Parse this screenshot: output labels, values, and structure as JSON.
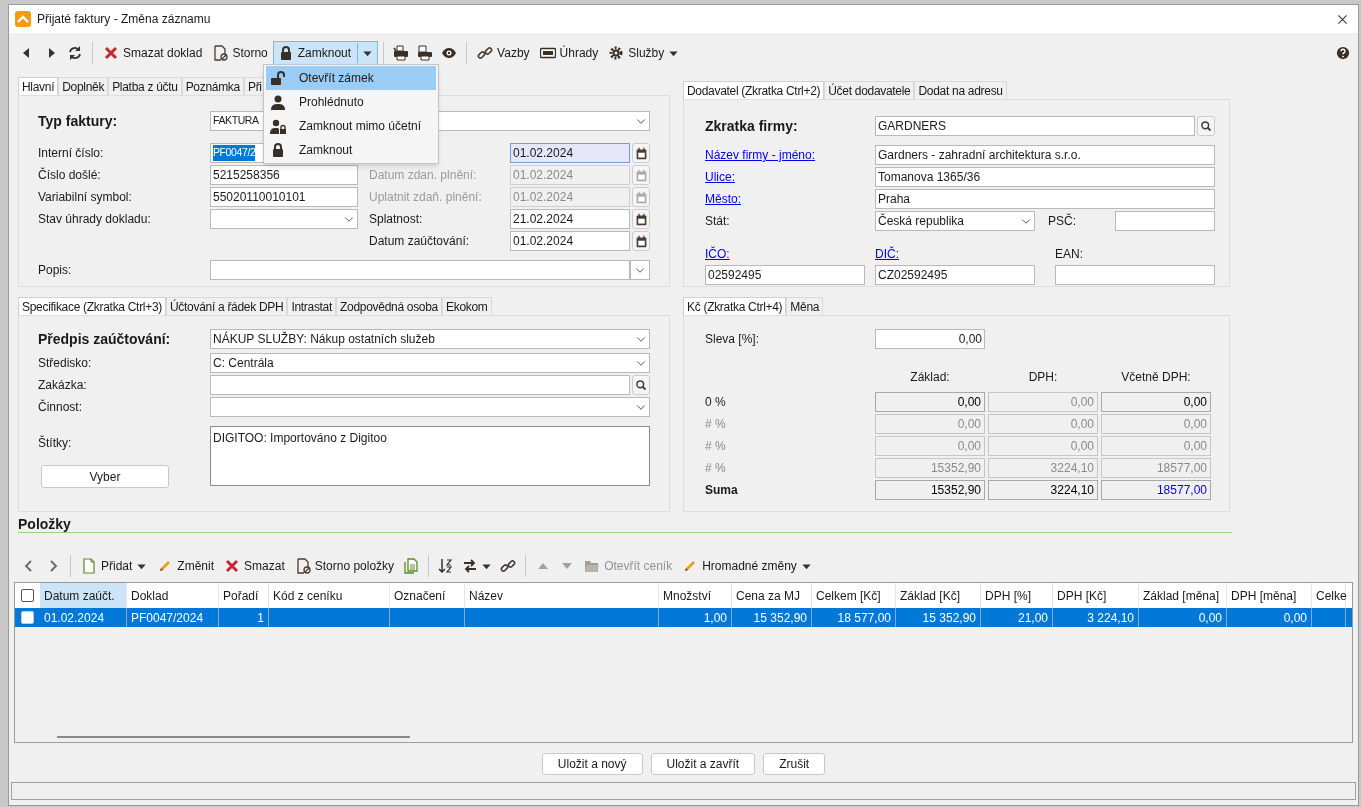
{
  "window": {
    "title": "Přijaté faktury - Změna záznamu"
  },
  "toolbar": {
    "items": [
      {
        "kind": "icon"
      },
      {
        "kind": "icon"
      },
      {
        "kind": "icon"
      },
      {
        "kind": "separator"
      },
      {
        "kind": "button",
        "label": "Smazat doklad"
      },
      {
        "kind": "button",
        "label": "Storno"
      },
      {
        "kind": "split",
        "label": "Zamknout",
        "expanded": true
      },
      {
        "kind": "separator"
      },
      {
        "kind": "icon"
      },
      {
        "kind": "icon"
      },
      {
        "kind": "icon"
      },
      {
        "kind": "separator"
      },
      {
        "kind": "button",
        "label": "Vazby"
      },
      {
        "kind": "button",
        "label": "Úhrady"
      },
      {
        "kind": "menu",
        "label": "Služby"
      }
    ]
  },
  "lock_menu": {
    "items": [
      {
        "label": "Otevřít zámek",
        "selected": true
      },
      {
        "label": "Prohlédnuto",
        "selected": false
      },
      {
        "label": "Zamknout mimo účetní",
        "selected": false
      },
      {
        "label": "Zamknout",
        "selected": false
      }
    ]
  },
  "main_form": {
    "tabs": [
      {
        "label": "Hlavní",
        "selected": true
      },
      {
        "label": "Doplněk",
        "selected": false
      },
      {
        "label": "Platba z účtu",
        "selected": false
      },
      {
        "label": "Poznámka",
        "selected": false
      },
      {
        "label": "Při",
        "selected": false
      }
    ],
    "invoice_type": {
      "label": "Typ faktury:",
      "value": "FAKTURA"
    },
    "fields": [
      {
        "label": "Interní číslo:",
        "value": "PF0047/2",
        "text_selected": true
      },
      {
        "label": "Číslo došlé:",
        "value": "5215258356",
        "text_selected": false
      },
      {
        "label": "Variabilní symbol:",
        "value": "55020110010101",
        "text_selected": false
      },
      {
        "label": "Stav úhrady dokladu:",
        "kind": "select"
      }
    ],
    "dates": [
      {
        "value": "01.02.2024",
        "focused": true,
        "disabled": false
      },
      {
        "label": "Datum zdan. plnění:",
        "value": "01.02.2024",
        "focused": false,
        "disabled": true
      },
      {
        "label": "Uplatnit zdaň. plnění:",
        "value": "01.02.2024",
        "focused": false,
        "disabled": true
      },
      {
        "label": "Splatnost:",
        "value": "21.02.2024",
        "focused": false,
        "disabled": false
      },
      {
        "label": "Datum zaúčtování:",
        "value": "01.02.2024",
        "focused": false,
        "disabled": false
      }
    ],
    "description": {
      "label": "Popis:"
    }
  },
  "supplier": {
    "tabs": [
      {
        "label": "Dodavatel (Zkratka Ctrl+2)",
        "selected": true
      },
      {
        "label": "Účet dodavatele",
        "selected": false
      },
      {
        "label": "Dodat na adresu",
        "selected": false
      }
    ],
    "short_name": {
      "label": "Zkratka firmy:",
      "value": "GARDNERS"
    },
    "fields": [
      {
        "label": "Název firmy - jméno:",
        "value": "Gardners - zahradní architektura s.r.o.",
        "link": true
      },
      {
        "label": "Ulice:",
        "value": "Tomanova 1365/36",
        "link": true
      },
      {
        "label": "Město:",
        "value": "Praha",
        "link": true
      }
    ],
    "country": {
      "label": "Stát:",
      "value": "Česká republika"
    },
    "postal_code": {
      "label": "PSČ:"
    },
    "ids": [
      {
        "label": "IČO:",
        "value": "02592495",
        "link": true
      },
      {
        "label": "DIČ:",
        "value": "CZ02592495",
        "link": true
      },
      {
        "label": "EAN:",
        "link": false
      }
    ]
  },
  "specification": {
    "tabs": [
      {
        "label": "Specifikace (Zkratka Ctrl+3)",
        "selected": true
      },
      {
        "label": "Účtování a řádek DPH",
        "selected": false
      },
      {
        "label": "Intrastat",
        "selected": false
      },
      {
        "label": "Zodpovědná osoba",
        "selected": false
      },
      {
        "label": "Ekokom",
        "selected": false
      }
    ],
    "posting": {
      "label": "Předpis zaúčtování:",
      "value": "NÁKUP SLUŽBY: Nákup ostatních služeb"
    },
    "fields": [
      {
        "label": "Středisko:",
        "value": "C: Centrála",
        "kind": "select"
      },
      {
        "label": "Zakázka:",
        "kind": "search"
      },
      {
        "label": "Činnost:",
        "kind": "select"
      }
    ],
    "tags": {
      "label": "Štítky:",
      "value": "DIGITOO: Importováno z Digitoo",
      "button": "Vyber"
    }
  },
  "amounts": {
    "tabs": [
      {
        "label": "Kč (Zkratka Ctrl+4)",
        "selected": true
      },
      {
        "label": "Měna",
        "selected": false
      }
    ],
    "discount": {
      "label": "Sleva [%]:",
      "value": "0,00"
    },
    "columns": [
      "Základ:",
      "DPH:",
      "Včetně DPH:"
    ],
    "rows": [
      {
        "label": "0 %",
        "kind": "rate",
        "disabled": false,
        "cells": [
          {
            "value": "0,00",
            "disabled": false,
            "emphasized": false
          },
          {
            "value": "0,00",
            "disabled": true,
            "emphasized": false
          },
          {
            "value": "0,00",
            "disabled": false,
            "emphasized": false
          }
        ]
      },
      {
        "label": "# %",
        "kind": "rate",
        "disabled": true,
        "cells": [
          {
            "value": "0,00",
            "disabled": true,
            "emphasized": false
          },
          {
            "value": "0,00",
            "disabled": true,
            "emphasized": false
          },
          {
            "value": "0,00",
            "disabled": true,
            "emphasized": false
          }
        ]
      },
      {
        "label": "# %",
        "kind": "rate",
        "disabled": true,
        "cells": [
          {
            "value": "0,00",
            "disabled": true,
            "emphasized": false
          },
          {
            "value": "0,00",
            "disabled": true,
            "emphasized": false
          },
          {
            "value": "0,00",
            "disabled": true,
            "emphasized": false
          }
        ]
      },
      {
        "label": "# %",
        "kind": "rate",
        "disabled": true,
        "cells": [
          {
            "value": "15352,90",
            "disabled": true,
            "emphasized": false
          },
          {
            "value": "3224,10",
            "disabled": true,
            "emphasized": false
          },
          {
            "value": "18577,00",
            "disabled": true,
            "emphasized": false
          }
        ]
      },
      {
        "label": "Suma",
        "kind": "total",
        "disabled": false,
        "cells": [
          {
            "value": "15352,90",
            "disabled": false,
            "emphasized": false
          },
          {
            "value": "3224,10",
            "disabled": false,
            "emphasized": false
          },
          {
            "value": "18577,00",
            "disabled": false,
            "emphasized": true
          }
        ]
      }
    ]
  },
  "items": {
    "title": "Položky",
    "toolbar": [
      {
        "kind": "icon",
        "disabled": false
      },
      {
        "kind": "icon",
        "disabled": false
      },
      {
        "kind": "separator"
      },
      {
        "kind": "menu",
        "label": "Přidat",
        "disabled": false
      },
      {
        "kind": "button",
        "label": "Změnit",
        "disabled": false
      },
      {
        "kind": "button",
        "label": "Smazat",
        "disabled": false
      },
      {
        "kind": "button",
        "label": "Storno položky",
        "disabled": false
      },
      {
        "kind": "icon",
        "disabled": false
      },
      {
        "kind": "separator"
      },
      {
        "kind": "icon",
        "disabled": false
      },
      {
        "kind": "icon-menu",
        "disabled": false
      },
      {
        "kind": "icon",
        "disabled": false
      },
      {
        "kind": "separator"
      },
      {
        "kind": "icon",
        "disabled": true
      },
      {
        "kind": "icon",
        "disabled": true
      },
      {
        "kind": "button",
        "label": "Otevřít ceník",
        "disabled": true
      },
      {
        "kind": "menu",
        "label": "Hromadné změny",
        "disabled": false
      }
    ],
    "header_checked": false,
    "columns": [
      {
        "label": "Datum zaúčt.",
        "selected": true
      },
      {
        "label": "Doklad",
        "selected": false
      },
      {
        "label": "Pořadí",
        "selected": false
      },
      {
        "label": "Kód z ceníku",
        "selected": false
      },
      {
        "label": "Označení",
        "selected": false
      },
      {
        "label": "Název",
        "selected": false
      },
      {
        "label": "Množství",
        "selected": false
      },
      {
        "label": "Cena za MJ",
        "selected": false
      },
      {
        "label": "Celkem [Kč]",
        "selected": false
      },
      {
        "label": "Základ [Kč]",
        "selected": false
      },
      {
        "label": "DPH [%]",
        "selected": false
      },
      {
        "label": "DPH [Kč]",
        "selected": false
      },
      {
        "label": "Základ [měna]",
        "selected": false
      },
      {
        "label": "DPH [měna]",
        "selected": false
      },
      {
        "label": "Celke",
        "selected": false
      }
    ],
    "rows": [
      {
        "selected": true,
        "checked": false,
        "cells": [
          "01.02.2024",
          "PF0047/2024",
          "1",
          null,
          null,
          null,
          "1,00",
          "15 352,90",
          "18 577,00",
          "15 352,90",
          "21,00",
          "3 224,10",
          "0,00",
          "0,00",
          null
        ]
      }
    ]
  },
  "buttons": [
    "Uložit a nový",
    "Uložit a zavřít",
    "Zrušit"
  ]
}
